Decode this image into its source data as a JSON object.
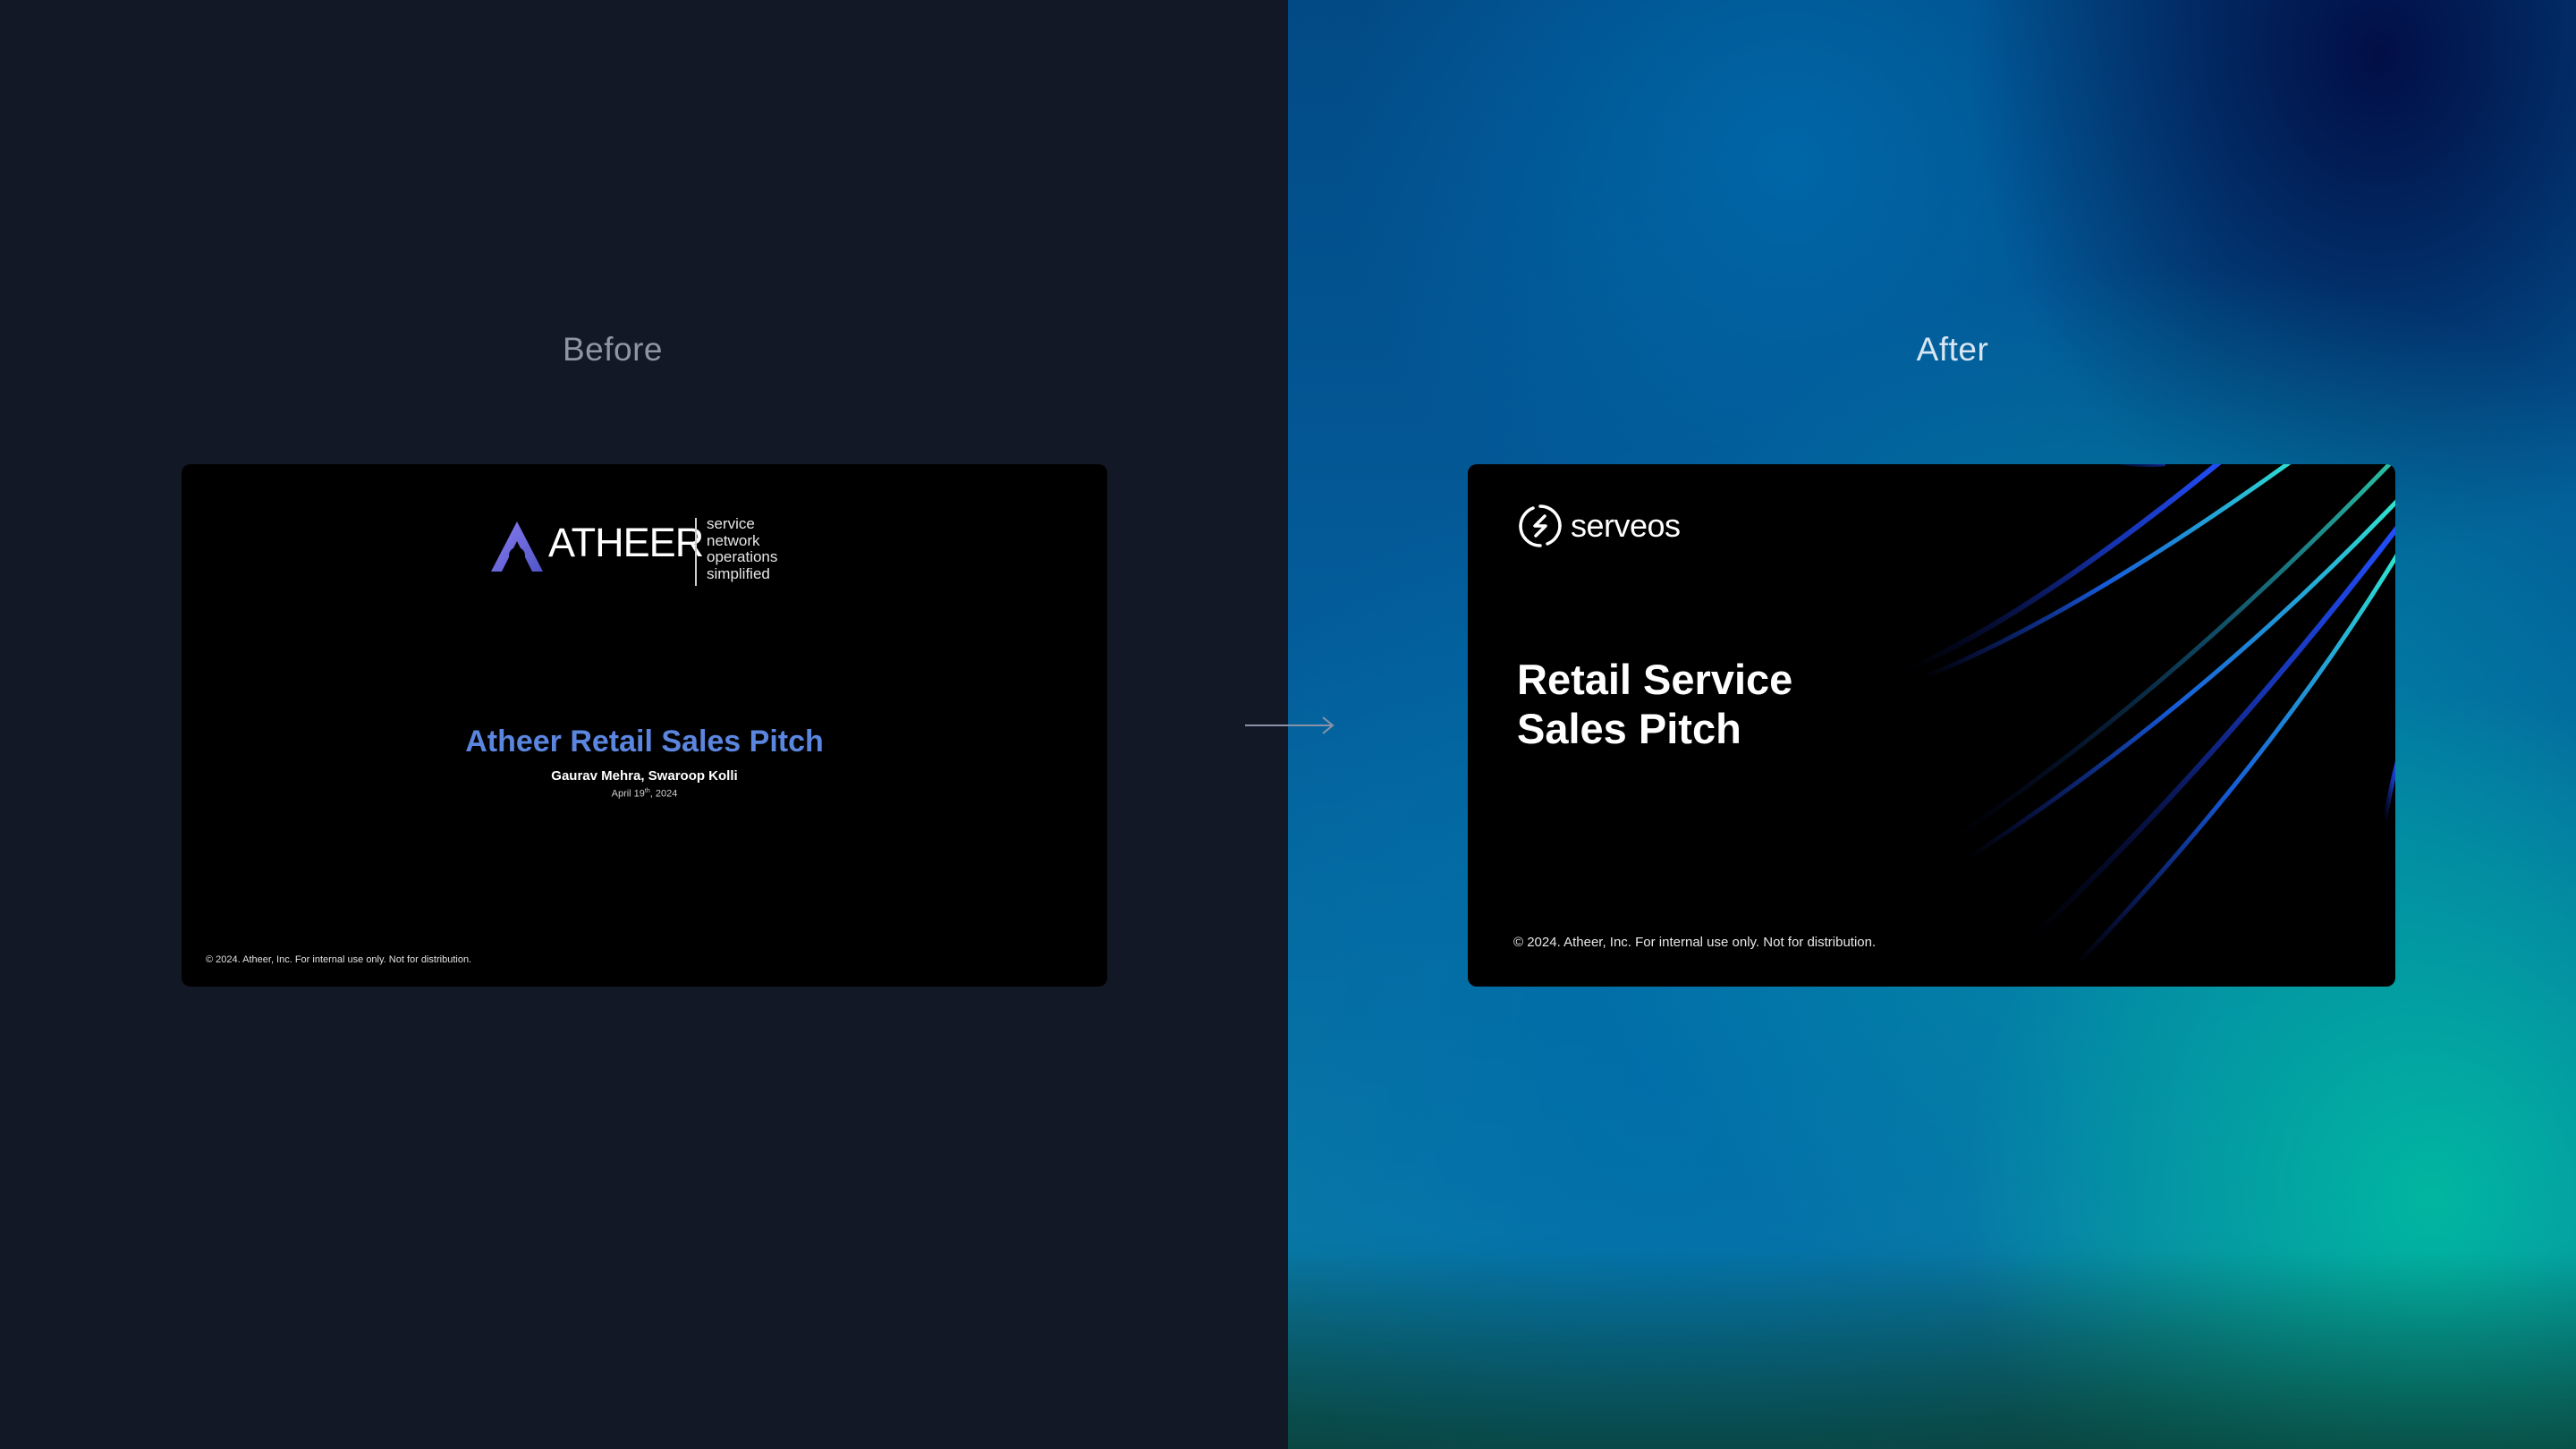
{
  "labels": {
    "before": "Before",
    "after": "After"
  },
  "before_slide": {
    "logo_wordmark": "ATHEER",
    "tagline": [
      "service",
      "network",
      "operations",
      "simplified"
    ],
    "title": "Atheer Retail Sales Pitch",
    "authors": "Gaurav Mehra, Swaroop Kolli",
    "date_main": "April 19",
    "date_suffix": "th",
    "date_year": ", 2024",
    "footer": "© 2024. Atheer, Inc. For internal use only. Not for distribution."
  },
  "after_slide": {
    "logo_wordmark": "serveos",
    "title_line1": "Retail Service",
    "title_line2": "Sales Pitch",
    "footer": "© 2024. Atheer, Inc. For internal use only. Not for distribution."
  },
  "colors": {
    "before_title": "#5b86e0",
    "background_left": "#131827",
    "atheer_mark": "#6f6fd8",
    "streak_cyan": "#2fe6d0",
    "streak_blue": "#1a5cff"
  },
  "icons": [
    "arrow-right-icon",
    "atheer-logo-icon",
    "serveos-logo-icon"
  ]
}
